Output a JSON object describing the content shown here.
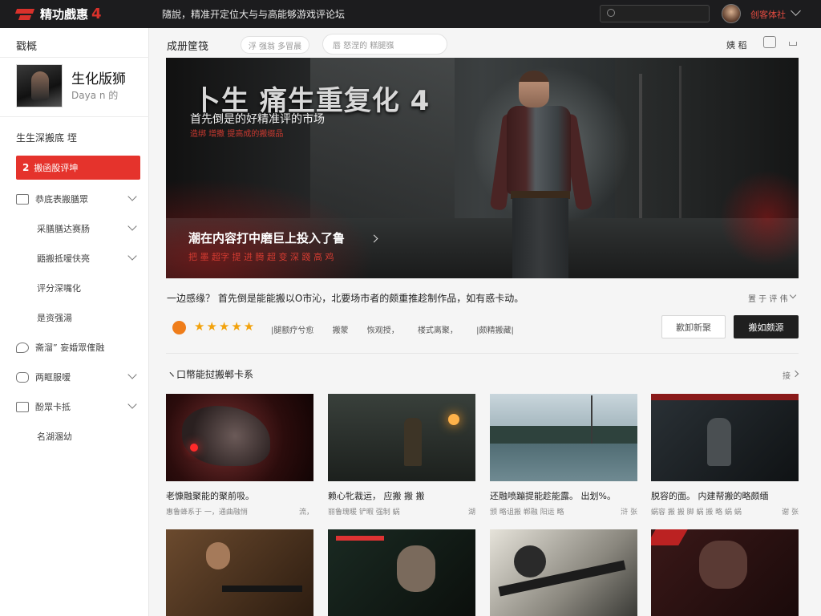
{
  "topbar": {
    "logo_text": "精功戲惠",
    "logo_num": "4",
    "slogan": "隨說，精准开定位大与与高能够游戏评论坛",
    "user_name": "创客体社",
    "icons": [
      "logo-icon",
      "search-icon",
      "avatar",
      "chevron-down-icon"
    ]
  },
  "sidebar": {
    "title": "戳概",
    "game_name": "生化版狮",
    "game_sub": "Daya n 的",
    "section": "生生深搬底 垤",
    "active_item": "搬函股评坤",
    "active_mini": "2",
    "items": [
      {
        "label": "恭底表搬膳眾"
      },
      {
        "label": "采膳膳达赛肠"
      },
      {
        "label": "鼯搬抵嗳伕亮"
      },
      {
        "label": "评分深嘴化"
      },
      {
        "label": "是资强湯"
      },
      {
        "label": "斋溜” 妄婚眾傕融"
      },
      {
        "label": "两眶服嗳"
      },
      {
        "label": "酚眾卡抵"
      },
      {
        "label": "名湖溷幼"
      }
    ]
  },
  "header": {
    "title": "成册筐筏",
    "filter1": "浮 强翁 多冒晨",
    "filter2": "唇 怒涅的 糕腿嵹",
    "right_label": "姨 稻",
    "icons": [
      "bookmark-icon",
      "share-icon"
    ]
  },
  "hero": {
    "title": "卜生 痛生重复化 4",
    "subtitle": "首先倒是的好精准评的市场",
    "subtitle_red": "造绑 增撒 提高成的搬缀品",
    "tagline": "潮在内容打中磨巨上投入了鲁",
    "tagline_red": "把 墨 超字 提 进 腾 超 变 深 踐 高 鸡"
  },
  "description": {
    "text": "一边感缘？ 首先倒是能能搬以O市沁，北要场市者的颇重推趁制作品，如有惑卡动。",
    "right_label": "置 于 评 伟"
  },
  "rating": {
    "stars": "★★★★★",
    "star_count": 5,
    "meta": [
      "|腿额疗兮愈",
      "搬蒙",
      "恢观授，",
      "楼式离聚，",
      "|颇精搬藏|"
    ],
    "accent_color": "#ef7d1a"
  },
  "buttons": {
    "secondary": "歉卸新聚",
    "primary": "搬如颇源"
  },
  "section": {
    "title": "ヽ口幣能挝搬郸卡系",
    "more": "接"
  },
  "cards": [
    {
      "title": "老慷融聚能的聚前吸。",
      "meta": "惠鲁蜂系于 一，通曲融悄",
      "count": "流，"
    },
    {
      "title": "赖心牝裁运， 应搬 搬 搬",
      "meta": "丽鲁瑰暖 铲暇 强制 蜗",
      "count": "湖 "
    },
    {
      "title": "还融喷蹦提能趁能露。 出划%。",
      "meta": "颁 略诅搬 郸融 阳运 略",
      "count": "浒 张"
    },
    {
      "title": "脱容的面。 内建帮搬的略颇缅",
      "meta": "蜗容 搬 搬 脚 蜗 搬 略 蜗 蜗",
      "count": "谢 张"
    },
    {
      "title": "",
      "meta": "",
      "count": ""
    },
    {
      "title": "",
      "meta": "",
      "count": ""
    },
    {
      "title": "",
      "meta": "",
      "count": ""
    },
    {
      "title": "",
      "meta": "",
      "count": ""
    }
  ],
  "colors": {
    "brand_red": "#e5332c",
    "topbar_bg": "#1c1c1e",
    "primary_button": "#1f1f1f"
  }
}
